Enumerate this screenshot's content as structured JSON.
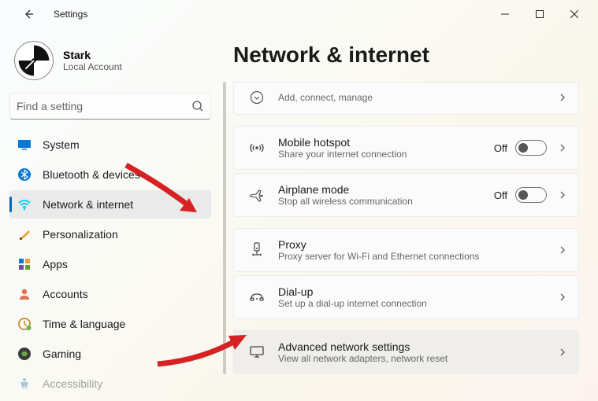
{
  "window": {
    "title": "Settings"
  },
  "profile": {
    "name": "Stark",
    "sub": "Local Account"
  },
  "search": {
    "placeholder": "Find a setting"
  },
  "nav": {
    "items": [
      {
        "label": "System"
      },
      {
        "label": "Bluetooth & devices"
      },
      {
        "label": "Network & internet"
      },
      {
        "label": "Personalization"
      },
      {
        "label": "Apps"
      },
      {
        "label": "Accounts"
      },
      {
        "label": "Time & language"
      },
      {
        "label": "Gaming"
      },
      {
        "label": "Accessibility"
      }
    ],
    "selectedIndex": 2
  },
  "page": {
    "title": "Network & internet"
  },
  "cards": [
    {
      "title": "",
      "sub": "Add, connect, manage",
      "toggle": null,
      "icon": "chevron-down"
    },
    {
      "title": "Mobile hotspot",
      "sub": "Share your internet connection",
      "toggle": "Off",
      "icon": "hotspot"
    },
    {
      "title": "Airplane mode",
      "sub": "Stop all wireless communication",
      "toggle": "Off",
      "icon": "airplane"
    },
    {
      "title": "Proxy",
      "sub": "Proxy server for Wi-Fi and Ethernet connections",
      "toggle": null,
      "icon": "proxy"
    },
    {
      "title": "Dial-up",
      "sub": "Set up a dial-up internet connection",
      "toggle": null,
      "icon": "dialup"
    },
    {
      "title": "Advanced network settings",
      "sub": "View all network adapters, network reset",
      "toggle": null,
      "icon": "monitor"
    }
  ]
}
